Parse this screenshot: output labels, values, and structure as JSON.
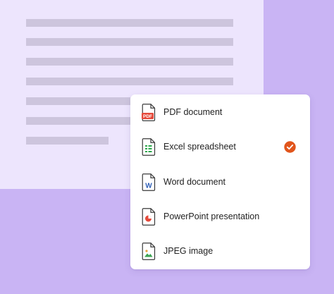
{
  "menu": {
    "items": [
      {
        "label": "PDF document",
        "icon": "pdf-file-icon",
        "selected": false
      },
      {
        "label": "Excel spreadsheet",
        "icon": "excel-file-icon",
        "selected": true
      },
      {
        "label": "Word document",
        "icon": "word-file-icon",
        "selected": false
      },
      {
        "label": "PowerPoint presentation",
        "icon": "powerpoint-file-icon",
        "selected": false
      },
      {
        "label": "JPEG image",
        "icon": "image-file-icon",
        "selected": false
      }
    ],
    "selected_icon": "checkmark-icon"
  },
  "icons": {
    "pdf_badge": "PDF",
    "word_badge": "W"
  },
  "colors": {
    "background": "#c9b4f4",
    "document_page": "#ede5fd",
    "text_placeholder": "#cdc5dd",
    "pdf_red": "#e5493a",
    "excel_green": "#2ea84d",
    "word_blue": "#2f5fb7",
    "powerpoint_red": "#e5493a",
    "image_green": "#3da453",
    "check_orange": "#e1551c"
  }
}
